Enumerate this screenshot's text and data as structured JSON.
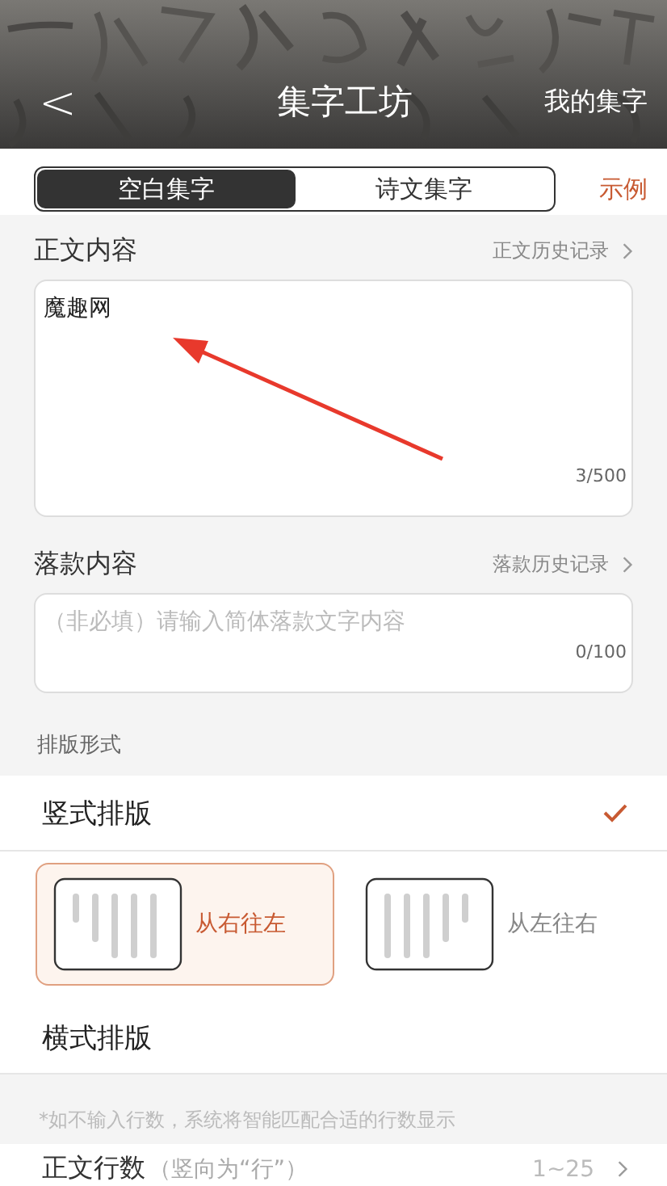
{
  "header": {
    "back": "<",
    "title": "集字工坊",
    "action": "我的集字"
  },
  "mode_tabs": [
    {
      "label": "空白集字",
      "selected": true
    },
    {
      "label": "诗文集字",
      "selected": false
    }
  ],
  "example_link": "示例",
  "body_text": {
    "label": "正文内容",
    "history": "正文历史记录",
    "value": "魔趣网",
    "counter": "3/500"
  },
  "signature": {
    "label": "落款内容",
    "history": "落款历史记录",
    "placeholder": "（非必填）请输入简体落款文字内容",
    "counter": "0/100"
  },
  "layout_label": "排版形式",
  "layouts": [
    {
      "label": "竖式排版",
      "selected": true,
      "options": [
        {
          "label": "从右往左",
          "kind": "rtl",
          "selected": true
        },
        {
          "label": "从左往右",
          "kind": "ltr",
          "selected": false
        }
      ]
    },
    {
      "label": "横式排版",
      "selected": false
    }
  ],
  "note": "*如不输入行数，系统将智能匹配合适的行数显示",
  "line_count": {
    "label": "正文行数",
    "hint": "（竖向为“行”）",
    "placeholder": "1~25"
  }
}
